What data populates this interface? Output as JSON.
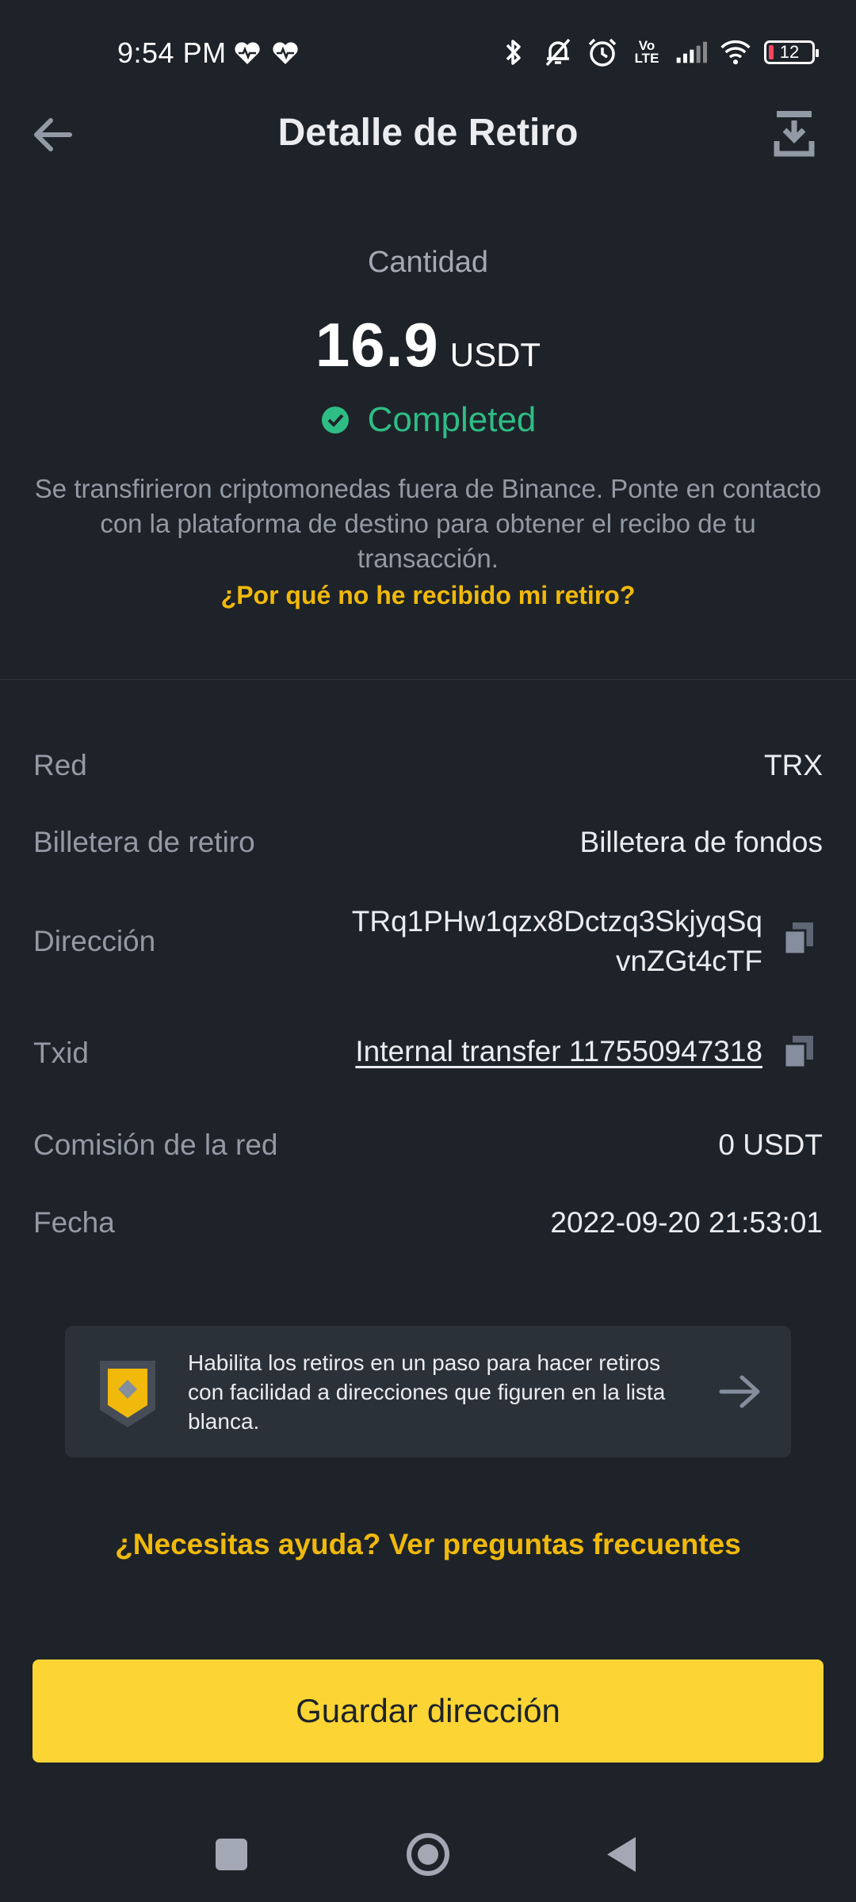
{
  "status_bar": {
    "time": "9:54 PM",
    "battery": "12",
    "volte_top": "Vo",
    "volte_bottom": "LTE"
  },
  "header": {
    "title": "Detalle de Retiro"
  },
  "summary": {
    "amount_label": "Cantidad",
    "amount": "16.9",
    "unit": "USDT",
    "status": "Completed",
    "info": "Se transfirieron criptomonedas fuera de Binance. Ponte en contacto con la plataforma de destino para obtener el recibo de tu transacción.",
    "why_link": "¿Por qué no he recibido mi retiro?"
  },
  "details": {
    "network": {
      "label": "Red",
      "value": "TRX"
    },
    "wallet": {
      "label": "Billetera de retiro",
      "value": "Billetera de fondos"
    },
    "address": {
      "label": "Dirección",
      "line1": "TRq1PHw1qzx8Dctzq3SkjyqSq",
      "line2": "vnZGt4cTF"
    },
    "txid": {
      "label": "Txid",
      "value": "Internal transfer 117550947318"
    },
    "fee": {
      "label": "Comisión de la red",
      "value": "0 USDT"
    },
    "date": {
      "label": "Fecha",
      "value": "2022-09-20 21:53:01"
    }
  },
  "promo": {
    "text": "Habilita los retiros en un paso para hacer retiros con facilidad a direcciones que figuren en la lista blanca."
  },
  "help_link": "¿Necesitas ayuda? Ver preguntas frecuentes",
  "save_button": "Guardar dirección",
  "colors": {
    "background": "#1e2329",
    "accent": "#f0b90b",
    "button": "#fcd535",
    "success": "#2ebd85",
    "muted_text": "#929aa5"
  }
}
